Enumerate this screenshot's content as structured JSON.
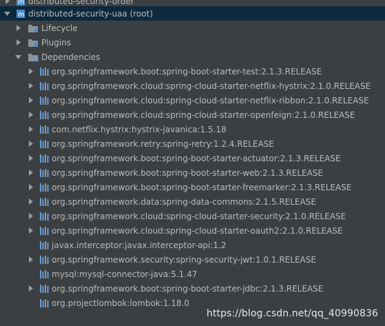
{
  "tree": {
    "partial_top_label": "distributed-security-order",
    "root_label": "distributed-security-uaa (root)",
    "lifecycle_label": "Lifecycle",
    "plugins_label": "Plugins",
    "dependencies_label": "Dependencies",
    "dependencies": [
      {
        "label": "org.springframework.boot:spring-boot-starter-test:2.1.3.RELEASE",
        "expandable": true
      },
      {
        "label": "org.springframework.cloud:spring-cloud-starter-netflix-hystrix:2.1.0.RELEASE",
        "expandable": true
      },
      {
        "label": "org.springframework.cloud:spring-cloud-starter-netflix-ribbon:2.1.0.RELEASE",
        "expandable": true
      },
      {
        "label": "org.springframework.cloud:spring-cloud-starter-openfeign:2.1.0.RELEASE",
        "expandable": true
      },
      {
        "label": "com.netflix.hystrix:hystrix-javanica:1.5.18",
        "expandable": true
      },
      {
        "label": "org.springframework.retry:spring-retry:1.2.4.RELEASE",
        "expandable": true
      },
      {
        "label": "org.springframework.boot:spring-boot-starter-actuator:2.1.3.RELEASE",
        "expandable": true
      },
      {
        "label": "org.springframework.boot:spring-boot-starter-web:2.1.3.RELEASE",
        "expandable": true
      },
      {
        "label": "org.springframework.boot:spring-boot-starter-freemarker:2.1.3.RELEASE",
        "expandable": true
      },
      {
        "label": "org.springframework.data:spring-data-commons:2.1.5.RELEASE",
        "expandable": true
      },
      {
        "label": "org.springframework.cloud:spring-cloud-starter-security:2.1.0.RELEASE",
        "expandable": true
      },
      {
        "label": "org.springframework.cloud:spring-cloud-starter-oauth2:2.1.0.RELEASE",
        "expandable": true
      },
      {
        "label": "javax.interceptor:javax.interceptor-api:1.2",
        "expandable": false
      },
      {
        "label": "org.springframework.security:spring-security-jwt:1.0.1.RELEASE",
        "expandable": true
      },
      {
        "label": "mysql:mysql-connector-java:5.1.47",
        "expandable": false
      },
      {
        "label": "org.springframework.boot:spring-boot-starter-jdbc:2.1.3.RELEASE",
        "expandable": true
      },
      {
        "label": "org.projectlombok:lombok:1.18.0",
        "expandable": false
      }
    ]
  },
  "watermark": "https://blog.csdn.net/qq_40990836",
  "colors": {
    "background": "#3c3f41",
    "selection": "#0d293e",
    "text": "#bbbbbb",
    "folder_icon": "#8c9399",
    "module_icon": "#4d8cc8",
    "library_bars": "#6a9fd4",
    "arrow": "#9a9da0"
  },
  "icons": {
    "expand": "triangle-right-icon",
    "collapse": "triangle-down-icon",
    "module": "maven-module-icon",
    "folder_lifecycle": "lifecycle-folder-icon",
    "folder_plugins": "plugins-folder-icon",
    "folder_dependencies": "dependencies-folder-icon",
    "library": "library-bars-icon"
  }
}
